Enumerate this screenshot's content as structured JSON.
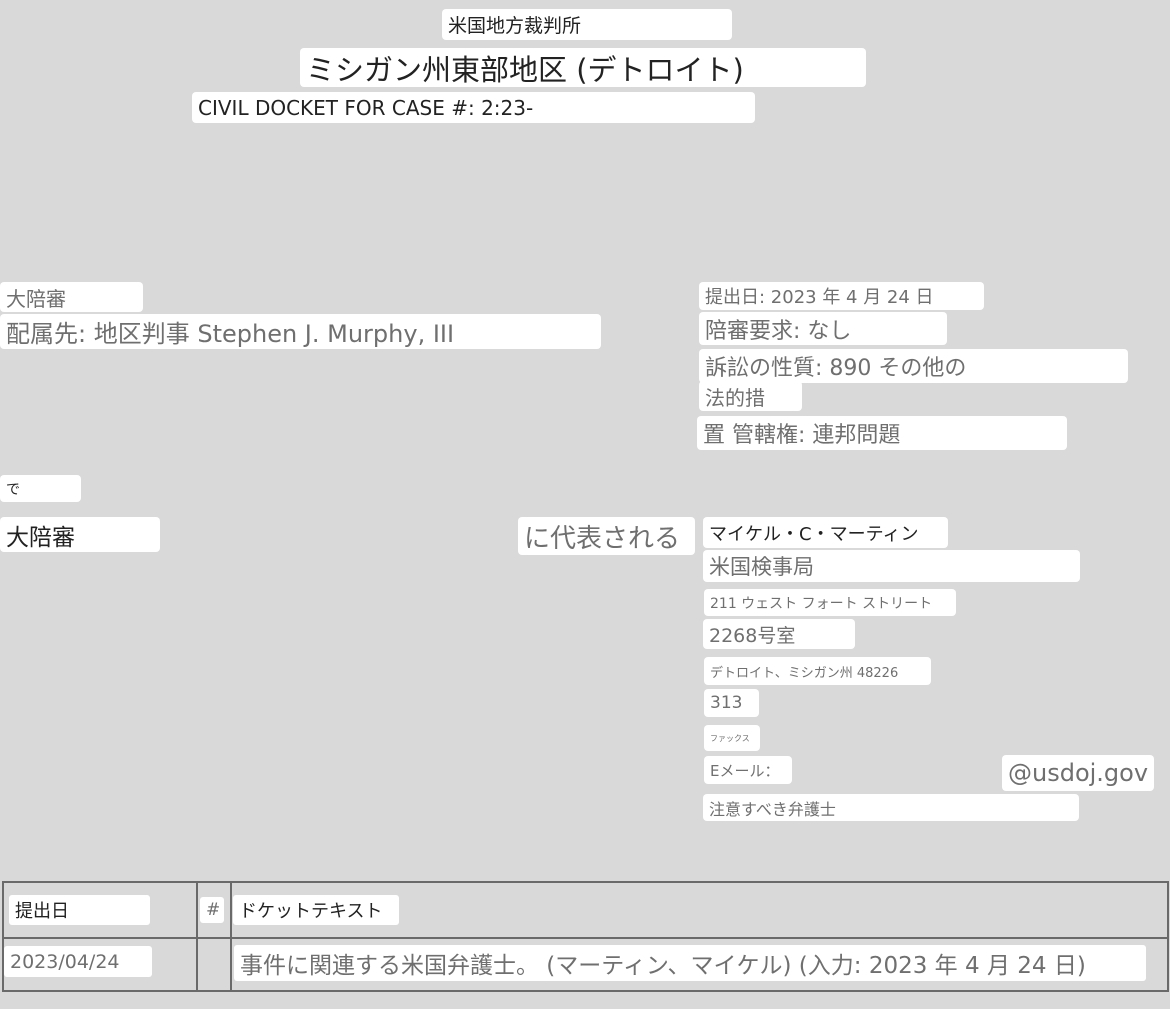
{
  "header": {
    "court": "米国地方裁判所",
    "district": "ミシガン州東部地区 (デトロイト)",
    "docket_title": "CIVIL DOCKET FOR CASE #: 2:23-"
  },
  "case": {
    "grand_jury": "大陪審",
    "assigned_to": "配属先: 地区判事 Stephen J. Murphy, III",
    "date_filed": "提出日: 2023 年 4 月 24 日",
    "jury_demand": "陪審要求: なし",
    "nature_of_suit_1": "訴訟の性質: 890 その他の",
    "nature_of_suit_2": "法的措",
    "nature_of_suit_3": "置 管轄権: 連邦問題"
  },
  "party": {
    "in_re": "で",
    "name": "大陪審",
    "represented_by": "に代表される"
  },
  "attorney": {
    "name": "マイケル・C・マーティン",
    "office": "米国検事局",
    "street": "211 ウェスト フォート ストリート",
    "suite": "2268号室",
    "city": "デトロイト、ミシガン州 48226",
    "phone": "313",
    "fax_label": "ファックス",
    "email_label": "Eメール：",
    "email_domain": "@usdoj.gov",
    "notice": "注意すべき弁護士"
  },
  "docket_table": {
    "headers": [
      "提出日",
      "#",
      "ドケットテキスト"
    ],
    "rows": [
      {
        "date": "2023/04/24",
        "number": "",
        "text": "事件に関連する米国弁護士。 (マーティン、マイケル) (入力: 2023 年 4 月 24 日)"
      }
    ]
  }
}
